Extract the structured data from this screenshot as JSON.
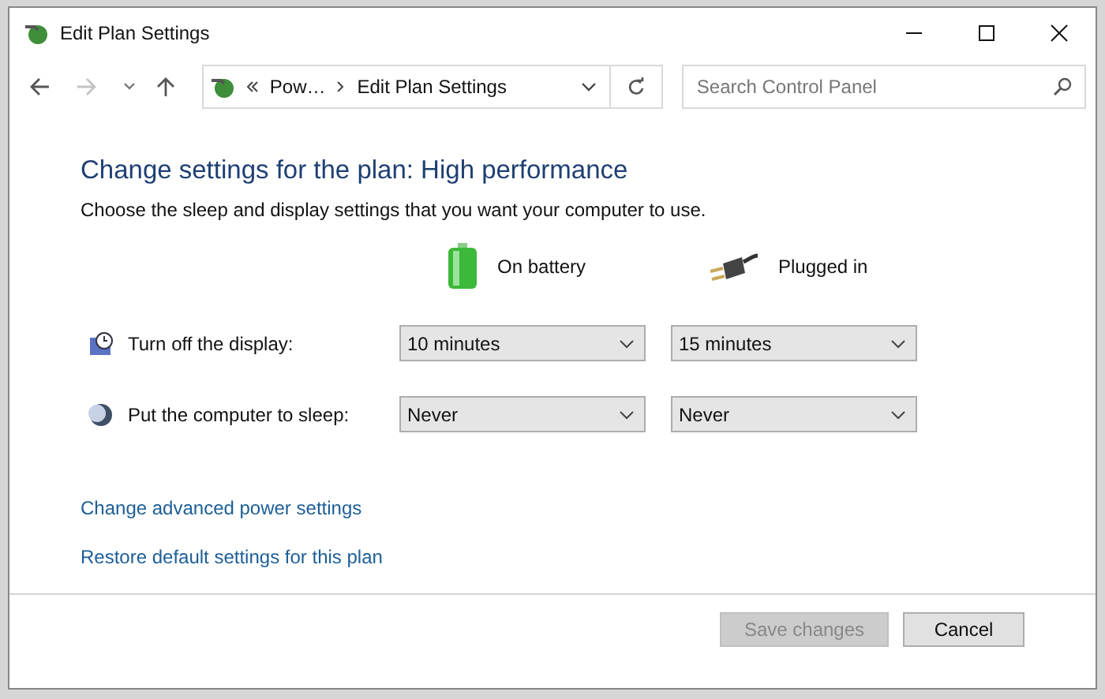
{
  "window": {
    "title": "Edit Plan Settings"
  },
  "nav": [
    {
      "kind": "back",
      "disabled": false
    },
    {
      "kind": "forward",
      "disabled": true
    },
    {
      "kind": "recent",
      "disabled": false
    },
    {
      "kind": "up",
      "disabled": false
    }
  ],
  "address": {
    "crumbs": [
      "Pow…",
      "Edit Plan Settings"
    ]
  },
  "search": {
    "placeholder": "Search Control Panel"
  },
  "heading": "Change settings for the plan: High performance",
  "subtitle": "Choose the sleep and display settings that you want your computer to use.",
  "columns": [
    {
      "kind": "battery",
      "label": "On battery"
    },
    {
      "kind": "plugged",
      "label": "Plugged in"
    }
  ],
  "settings": [
    {
      "kind": "display",
      "label": "Turn off the display:",
      "values": [
        "10 minutes",
        "15 minutes"
      ]
    },
    {
      "kind": "sleep",
      "label": "Put the computer to sleep:",
      "values": [
        "Never",
        "Never"
      ]
    }
  ],
  "links": [
    "Change advanced power settings",
    "Restore default settings for this plan"
  ],
  "buttons": [
    {
      "label": "Save changes",
      "disabled": true
    },
    {
      "label": "Cancel",
      "disabled": false
    }
  ]
}
